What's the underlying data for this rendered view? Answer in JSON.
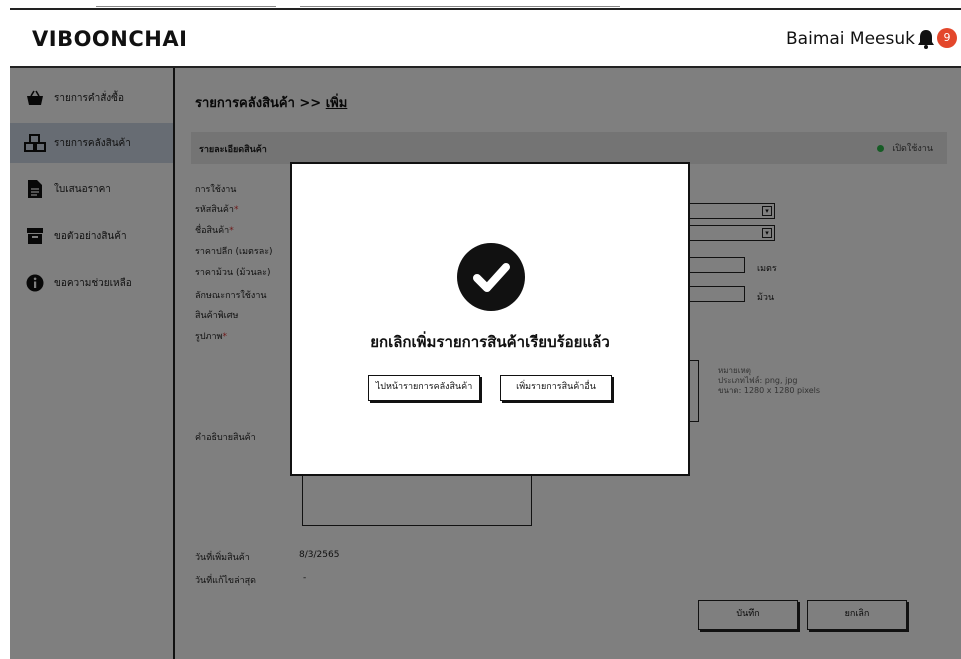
{
  "app": {
    "logo": "VIBOONCHAI",
    "user_name": "Baimai Meesuk",
    "notification_count": "9"
  },
  "sidebar": {
    "items": [
      {
        "label": "รายการคำสั่งซื้อ",
        "icon": "basket-icon"
      },
      {
        "label": "รายการคลังสินค้า",
        "icon": "boxes-icon"
      },
      {
        "label": "ใบเสนอราคา",
        "icon": "document-icon"
      },
      {
        "label": "ขอตัวอย่างสินค้า",
        "icon": "box-icon"
      },
      {
        "label": "ขอความช่วยเหลือ",
        "icon": "info-icon"
      }
    ]
  },
  "main": {
    "breadcrumb": {
      "parent": "รายการคลังสินค้า >> ",
      "current": "เพิ่ม"
    },
    "section_title": "รายละเอียดสินค้า",
    "status_label": "เปิดใช้งาน",
    "fields": {
      "usage": "การใช้งาน",
      "product_code": "รหัสสินค้า",
      "product_name": "ชื่อสินค้า",
      "retail_price": "ราคาปลีก (เมตรละ)",
      "roll_price": "ราคาม้วน (ม้วนละ)",
      "usage_type": "ลักษณะการใช้งาน",
      "special": "สินค้าพิเศษ",
      "image": "รูปภาพ",
      "description": "คำอธิบายสินค้า",
      "required_mark": "*"
    },
    "units": {
      "meter": "เมตร",
      "roll": "ม้วน"
    },
    "image_hint": [
      "หมายเหตุ",
      "ประเภทไฟล์: png, jpg",
      "ขนาด: 1280 x 1280 pixels"
    ],
    "meta": {
      "added_label": "วันที่เพิ่มสินค้า",
      "added_value": "8/3/2565",
      "updated_label": "วันที่แก้ไขล่าสุด",
      "updated_value": "-"
    },
    "save_label": "บันทึก",
    "cancel_label": "ยกเลิก"
  },
  "modal": {
    "message": "ยกเลิกเพิ่มรายการสินค้าเรียบร้อยแล้ว",
    "btn_go_inventory": "ไปหน้ารายการคลังสินค้า",
    "btn_add_other": "เพิ่มรายการสินค้าอื่น"
  },
  "colors": {
    "overlay": "#000000",
    "active_sidebar": "#cfd8e6",
    "status_green": "#2db84b",
    "badge_red": "#e3472b"
  }
}
